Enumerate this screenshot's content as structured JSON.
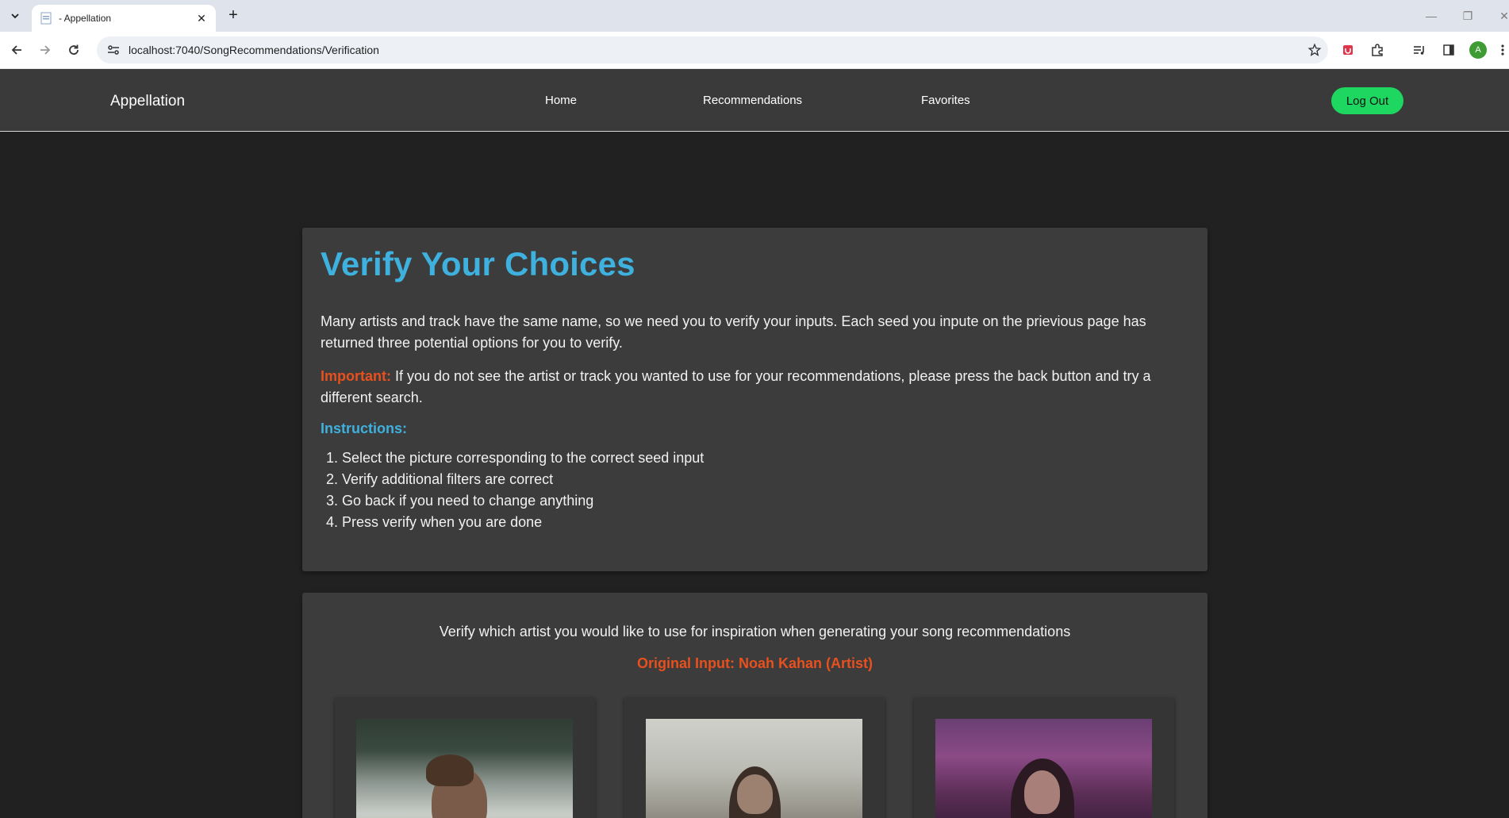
{
  "browser": {
    "tab_title": "- Appellation",
    "url": "localhost:7040/SongRecommendations/Verification",
    "profile_initial": "A"
  },
  "navbar": {
    "brand": "Appellation",
    "links": [
      "Home",
      "Recommendations",
      "Favorites"
    ],
    "logout_label": "Log Out"
  },
  "verify": {
    "title": "Verify Your Choices",
    "intro": "Many artists and track have the same name, so we need you to verify your inputs. Each seed you inpute on the prievious page has returned three potential options for you to verify.",
    "important_label": "Important:",
    "important_text": " If you do not see the artist or track you wanted to use for your recommendations, please press the back button and try a different search.",
    "instructions_title": "Instructions:",
    "instructions": [
      "Select the picture corresponding to the correct seed input",
      "Verify additional filters are correct",
      "Go back if you need to change anything",
      "Press verify when you are done"
    ]
  },
  "artist_choice": {
    "prompt": "Verify which artist you would like to use for inspiration when generating your song recommendations",
    "original_input": "Original Input: Noah Kahan (Artist)"
  },
  "colors": {
    "accent_blue": "#3eb1de",
    "important_orange": "#e8501d",
    "spotify_green": "#1ed760"
  }
}
